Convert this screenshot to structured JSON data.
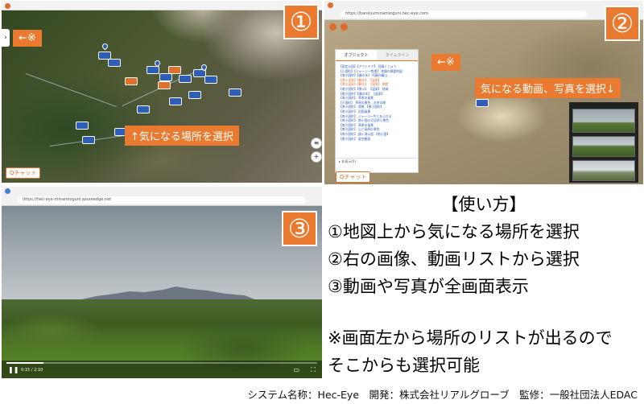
{
  "panel1": {
    "badge": "①",
    "left_callout": "←※",
    "bottom_callout": "↑気になる場所を選択",
    "chip_label": "Qチャット",
    "side_tab": "›"
  },
  "panel2": {
    "badge": "②",
    "url": "https://bankuuminamioguni.hec-eye.com",
    "left_callout": "←※",
    "right_callout": "気になる動画、写真を選択↓",
    "tabs": [
      "オブジェクト",
      "タイムライン"
    ],
    "list_items": [
      {
        "text": "【国定公園】【アウトドア】 阿蘇くじゅう",
        "color": "blue"
      },
      {
        "text": "【小国町】【ジャージー牧場】 地域の概要地図",
        "color": "blue"
      },
      {
        "text": "【南小国町】【瀬の本】 阿蘇外輪山",
        "color": "blue"
      },
      {
        "text": "【黒川温泉】【観光】 【温泉】",
        "color": "orange"
      },
      {
        "text": "【黒川温泉】【観光】 【温泉】 旅館",
        "color": "orange"
      },
      {
        "text": "【南小国町】【黒川】 【温泉】 地域",
        "color": "blue"
      },
      {
        "text": "【南小国町】【瀬の本】 【温泉】",
        "color": "blue"
      },
      {
        "text": "【南小国町】 草原の風景",
        "color": "blue"
      },
      {
        "text": "【小国町】 草原の景色、お茶の間",
        "color": "blue"
      },
      {
        "text": "【南小国町】 遠景  【南小国町】",
        "color": "blue"
      },
      {
        "text": "【南小国町】 田園風景",
        "color": "blue"
      },
      {
        "text": "【南小国町】 ジャージー牛とあふれる",
        "color": "blue"
      },
      {
        "text": "【南小国町】 南小国の大自然と景色",
        "color": "blue"
      },
      {
        "text": "【南小国町】 草原の風景",
        "color": "blue"
      },
      {
        "text": "【南小国町】 山と高原の景色",
        "color": "blue"
      },
      {
        "text": "【南小国町】 鍋ヶ滝公園 【南小国】",
        "color": "blue"
      },
      {
        "text": "【南小国町】 星空観測",
        "color": "blue"
      }
    ],
    "collapsed_row": "▸ 非表示(0)",
    "chip_label": "Qチャット"
  },
  "panel3": {
    "badge": "③",
    "url": "https://hec-eye-minamioguni.azureedge.net",
    "time": "0:15 / 2:10",
    "progress": 0.12
  },
  "instructions": {
    "title": "【使い方】",
    "step1": "①地図上から気になる場所を選択",
    "step2": "②右の画像、動画リストから選択",
    "step3": "③動画や写真が全画面表示",
    "note1": "※画面左から場所のリストが出るので",
    "note2": "そこからも選択可能"
  },
  "footer": "システム名称：Hec-Eye　開発：株式会社リアルグローブ　監修：一般社団法人EDAC",
  "colors": {
    "accent": "#ea7a2f",
    "marker": "#2e5fb8"
  }
}
